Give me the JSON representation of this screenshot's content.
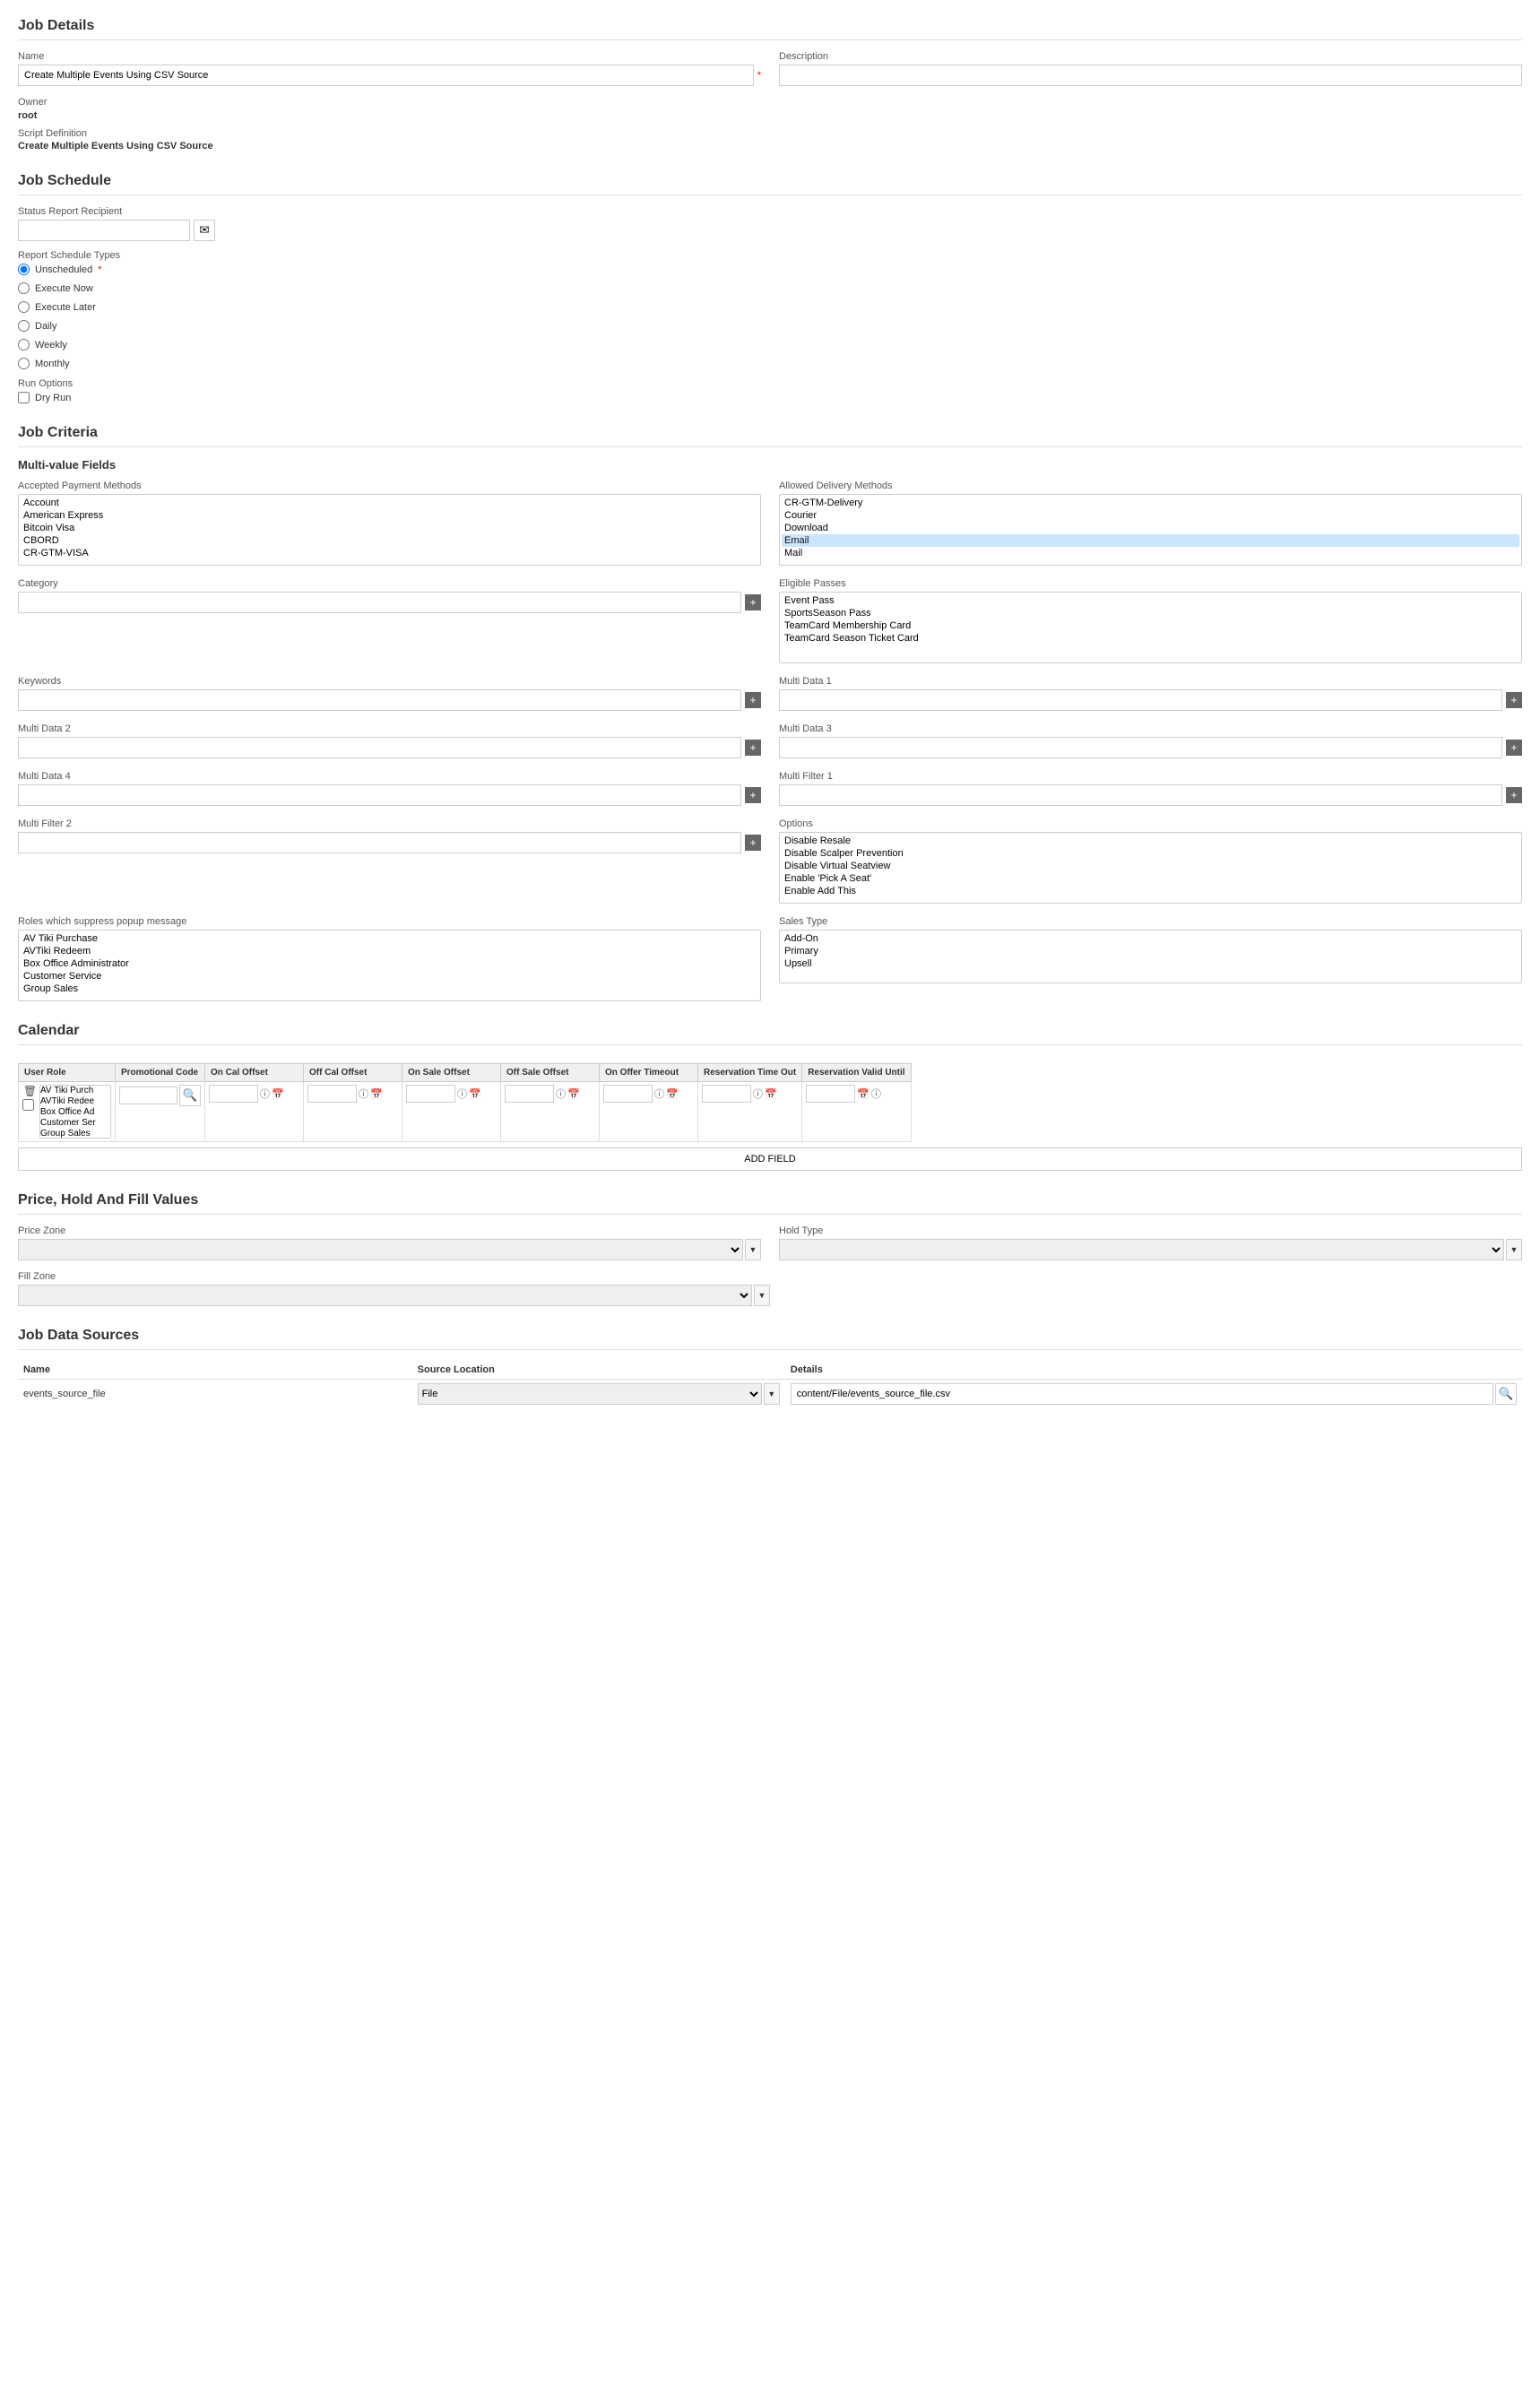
{
  "jobDetails": {
    "title": "Job Details",
    "nameLabel": "Name",
    "nameValue": "Create Multiple Events Using CSV Source",
    "nameRequired": true,
    "descriptionLabel": "Description",
    "descriptionValue": "",
    "ownerLabel": "Owner",
    "ownerValue": "root",
    "scriptDefLabel": "Script Definition",
    "scriptDefValue": "Create Multiple Events Using CSV Source"
  },
  "jobSchedule": {
    "title": "Job Schedule",
    "statusRecipientLabel": "Status Report Recipient",
    "statusRecipientValue": "",
    "reportScheduleLabel": "Report Schedule Types",
    "scheduleOptions": [
      {
        "id": "unscheduled",
        "label": "Unscheduled",
        "selected": true
      },
      {
        "id": "execute-now",
        "label": "Execute Now",
        "selected": false
      },
      {
        "id": "execute-later",
        "label": "Execute Later",
        "selected": false
      },
      {
        "id": "daily",
        "label": "Daily",
        "selected": false
      },
      {
        "id": "weekly",
        "label": "Weekly",
        "selected": false
      },
      {
        "id": "monthly",
        "label": "Monthly",
        "selected": false
      }
    ],
    "runOptionsLabel": "Run Options",
    "dryRunLabel": "Dry Run"
  },
  "jobCriteria": {
    "title": "Job Criteria",
    "multiValueTitle": "Multi-value Fields",
    "acceptedPaymentLabel": "Accepted Payment Methods",
    "acceptedPaymentOptions": [
      "Account",
      "American Express",
      "Bitcoin Visa",
      "CBORD",
      "CR-GTM-VISA"
    ],
    "allowedDeliveryLabel": "Allowed Delivery Methods",
    "allowedDeliveryOptions": [
      "CR-GTM-Delivery",
      "Courier",
      "Download",
      "Email",
      "Mail"
    ],
    "allowedDeliverySelected": "Email",
    "categoryLabel": "Category",
    "categoryValue": "",
    "eligiblePassesLabel": "Eligible Passes",
    "eligiblePassesOptions": [
      "Event Pass",
      "SportsSeason Pass",
      "TeamCard Membership Card",
      "TeamCard Season Ticket Card"
    ],
    "keywordsLabel": "Keywords",
    "keywordsValue": "",
    "multiData1Label": "Multi Data 1",
    "multiData1Value": "",
    "multiData2Label": "Multi Data 2",
    "multiData2Value": "",
    "multiData3Label": "Multi Data 3",
    "multiData3Value": "",
    "multiData4Label": "Multi Data 4",
    "multiData4Value": "",
    "multiFilter1Label": "Multi Filter 1",
    "multiFilter1Value": "",
    "multiFilter2Label": "Multi Filter 2",
    "multiFilter2Value": "",
    "optionsLabel": "Options",
    "optionsValues": [
      "Disable Resale",
      "Disable Scalper Prevention",
      "Disable Virtual Seatview",
      "Enable 'Pick A Seat'",
      "Enable Add This"
    ],
    "rolesPopupLabel": "Roles which suppress popup message",
    "rolesPopupOptions": [
      "AV Tiki Purchase",
      "AVTiki Redeem",
      "Box Office Administrator",
      "Customer Service",
      "Group Sales"
    ],
    "salesTypeLabel": "Sales Type",
    "salesTypeOptions": [
      "Add-On",
      "Primary",
      "Upsell"
    ]
  },
  "calendar": {
    "title": "Calendar",
    "columns": {
      "userRole": "User Role",
      "promoCode": "Promotional Code",
      "onCalOffset": "On Cal Offset",
      "offCalOffset": "Off Cal Offset",
      "onSaleOffset": "On Sale Offset",
      "offSaleOffset": "Off Sale Offset",
      "onOfferTimeout": "On Offer Timeout",
      "reservationTimeOut": "Reservation Time Out",
      "reservationValidUntil": "Reservation Valid Until"
    },
    "row": {
      "userRoleOptions": [
        "AV Tiki Purch",
        "AVTiki Redee",
        "Box Office Ad",
        "Customer Ser",
        "Group Sales"
      ],
      "promoCodeValue": ""
    },
    "addFieldLabel": "ADD FIELD"
  },
  "priceHoldFill": {
    "title": "Price, Hold And Fill Values",
    "priceZoneLabel": "Price Zone",
    "priceZoneValue": "",
    "holdTypeLabel": "Hold Type",
    "holdTypeValue": "",
    "fillZoneLabel": "Fill Zone",
    "fillZoneValue": ""
  },
  "jobDataSources": {
    "title": "Job Data Sources",
    "nameLabel": "Name",
    "sourceLocationLabel": "Source Location",
    "detailsLabel": "Details",
    "row": {
      "name": "events_source_file",
      "sourceLocation": "File",
      "details": "content/File/events_source_file.csv"
    }
  }
}
